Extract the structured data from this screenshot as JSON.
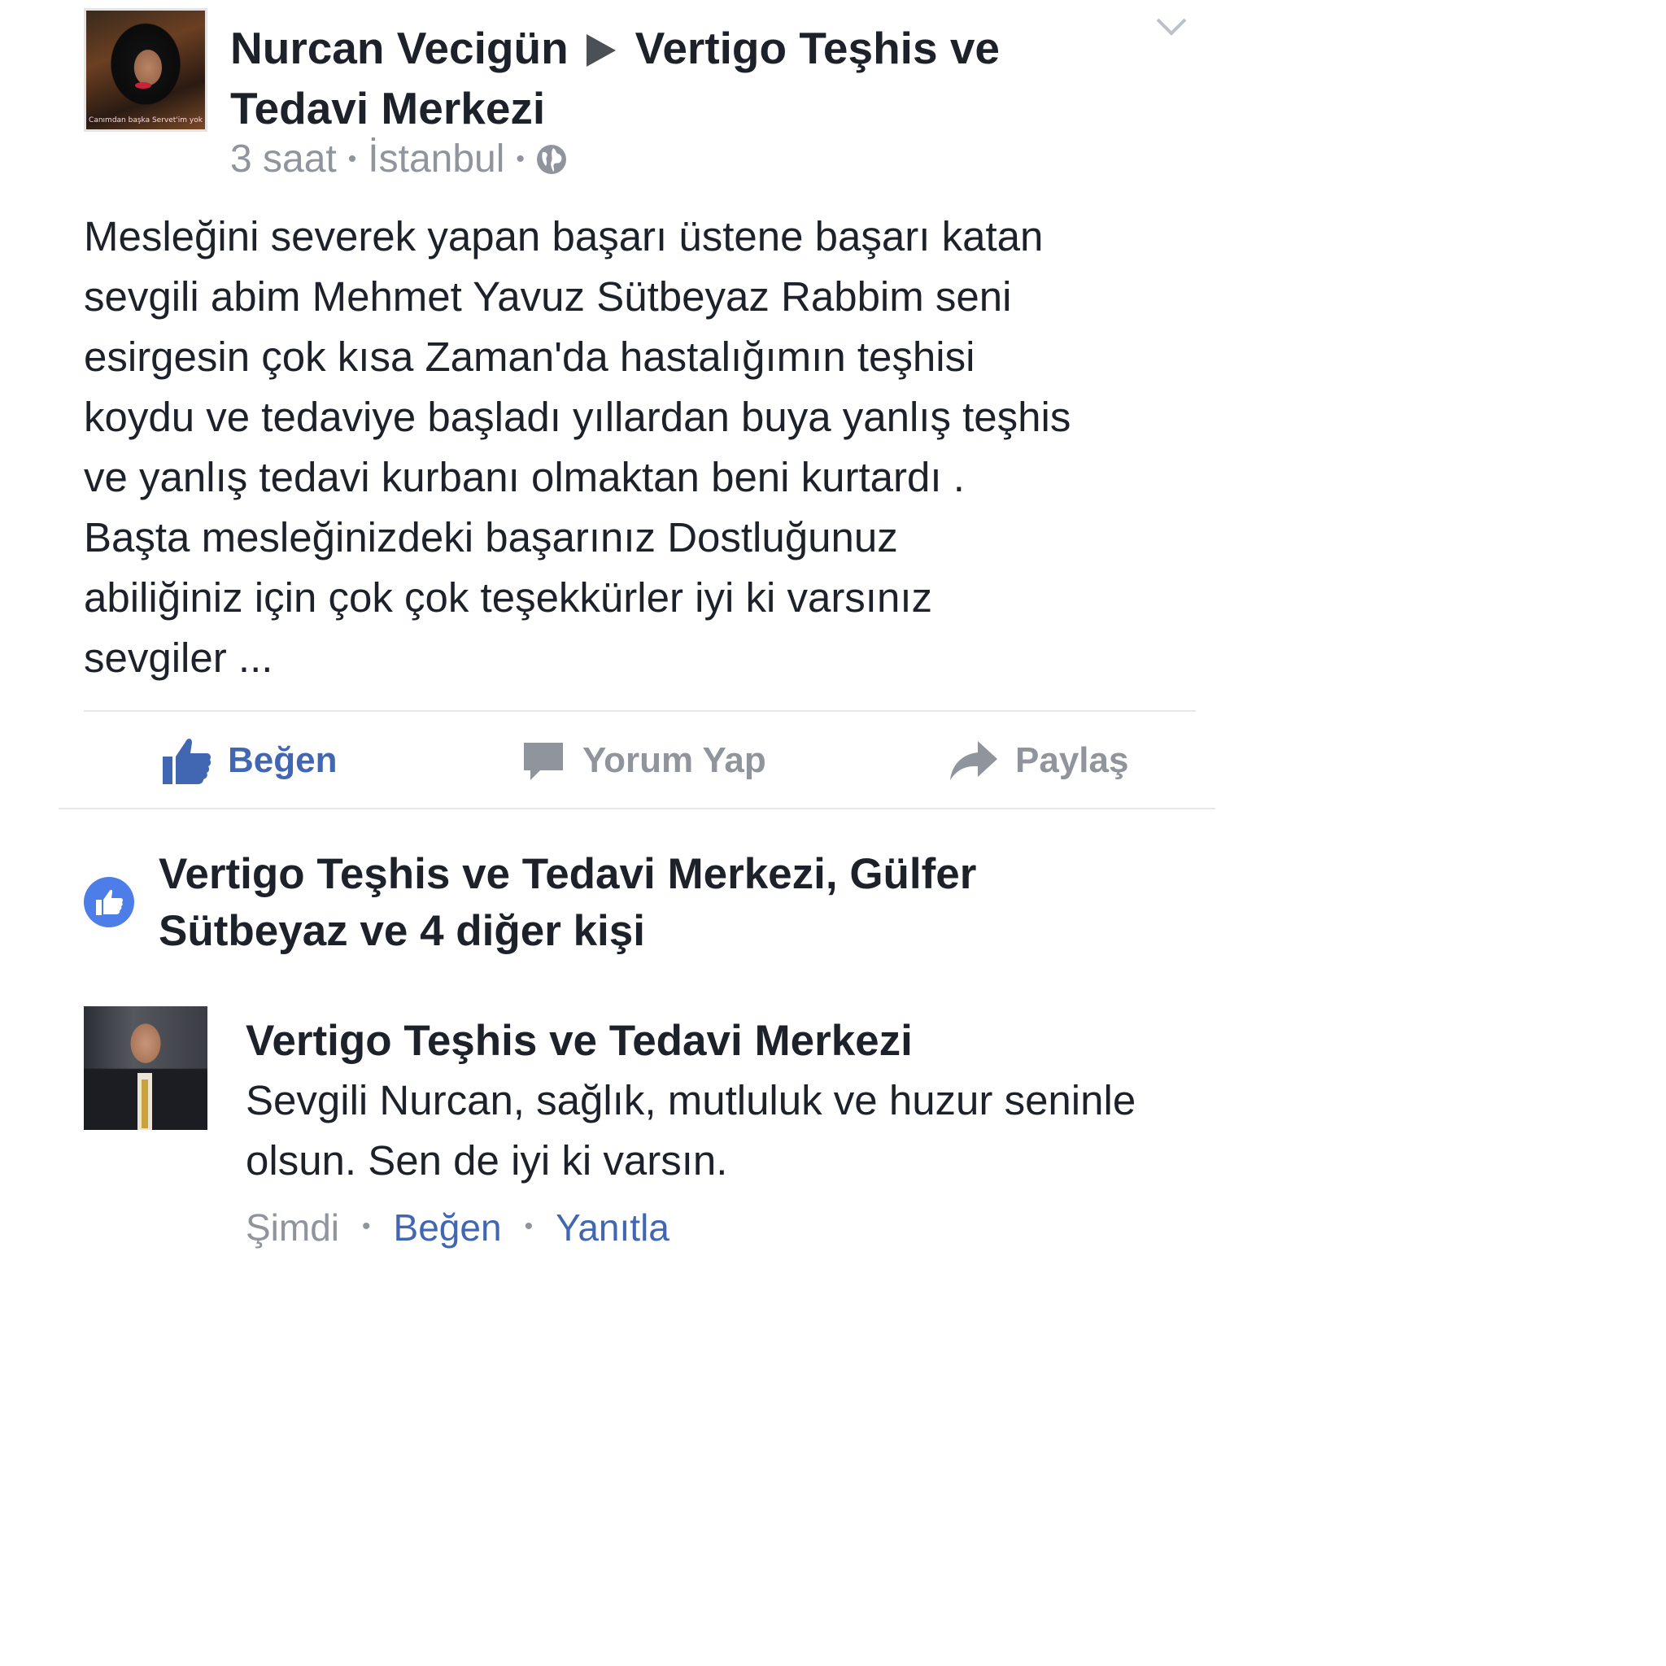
{
  "post": {
    "author": "Nurcan Vecigün",
    "target": "Vertigo Teşhis ve Tedavi Merkezi",
    "time": "3 saat",
    "location": "İstanbul",
    "privacy_icon": "globe-icon",
    "avatar_caption": "Canımdan başka Servet'im yok",
    "text": "Mesleğini severek yapan başarı üstene başarı katan\nsevgili abim Mehmet Yavuz Sütbeyaz Rabbim seni\nesirgesin çok kısa Zaman'da hastalığımın  teşhisi\nkoydu ve tedaviye başladı yıllardan buya yanlış teşhis\nve yanlış tedavi kurbanı olmaktan  beni kurtardı .\nBaşta mesleğinizdeki başarınız Dostluğunuz\nabiliğiniz için çok çok teşekkürler iyi ki varsınız\nsevgiler ..."
  },
  "actions": {
    "like": "Beğen",
    "comment": "Yorum Yap",
    "share": "Paylaş"
  },
  "likes": {
    "text": "Vertigo Teşhis ve Tedavi Merkezi, Gülfer Sütbeyaz ve 4 diğer kişi"
  },
  "comment": {
    "author": "Vertigo Teşhis ve Tedavi Merkezi",
    "text": "Sevgili Nurcan, sağlık, mutluluk ve huzur seninle olsun. Sen de iyi ki varsın.",
    "time": "Şimdi",
    "like": "Beğen",
    "reply": "Yanıtla"
  },
  "colors": {
    "accent": "#4267b2",
    "muted": "#90949c",
    "text": "#1d2129",
    "like_badge": "#4c7de8"
  }
}
